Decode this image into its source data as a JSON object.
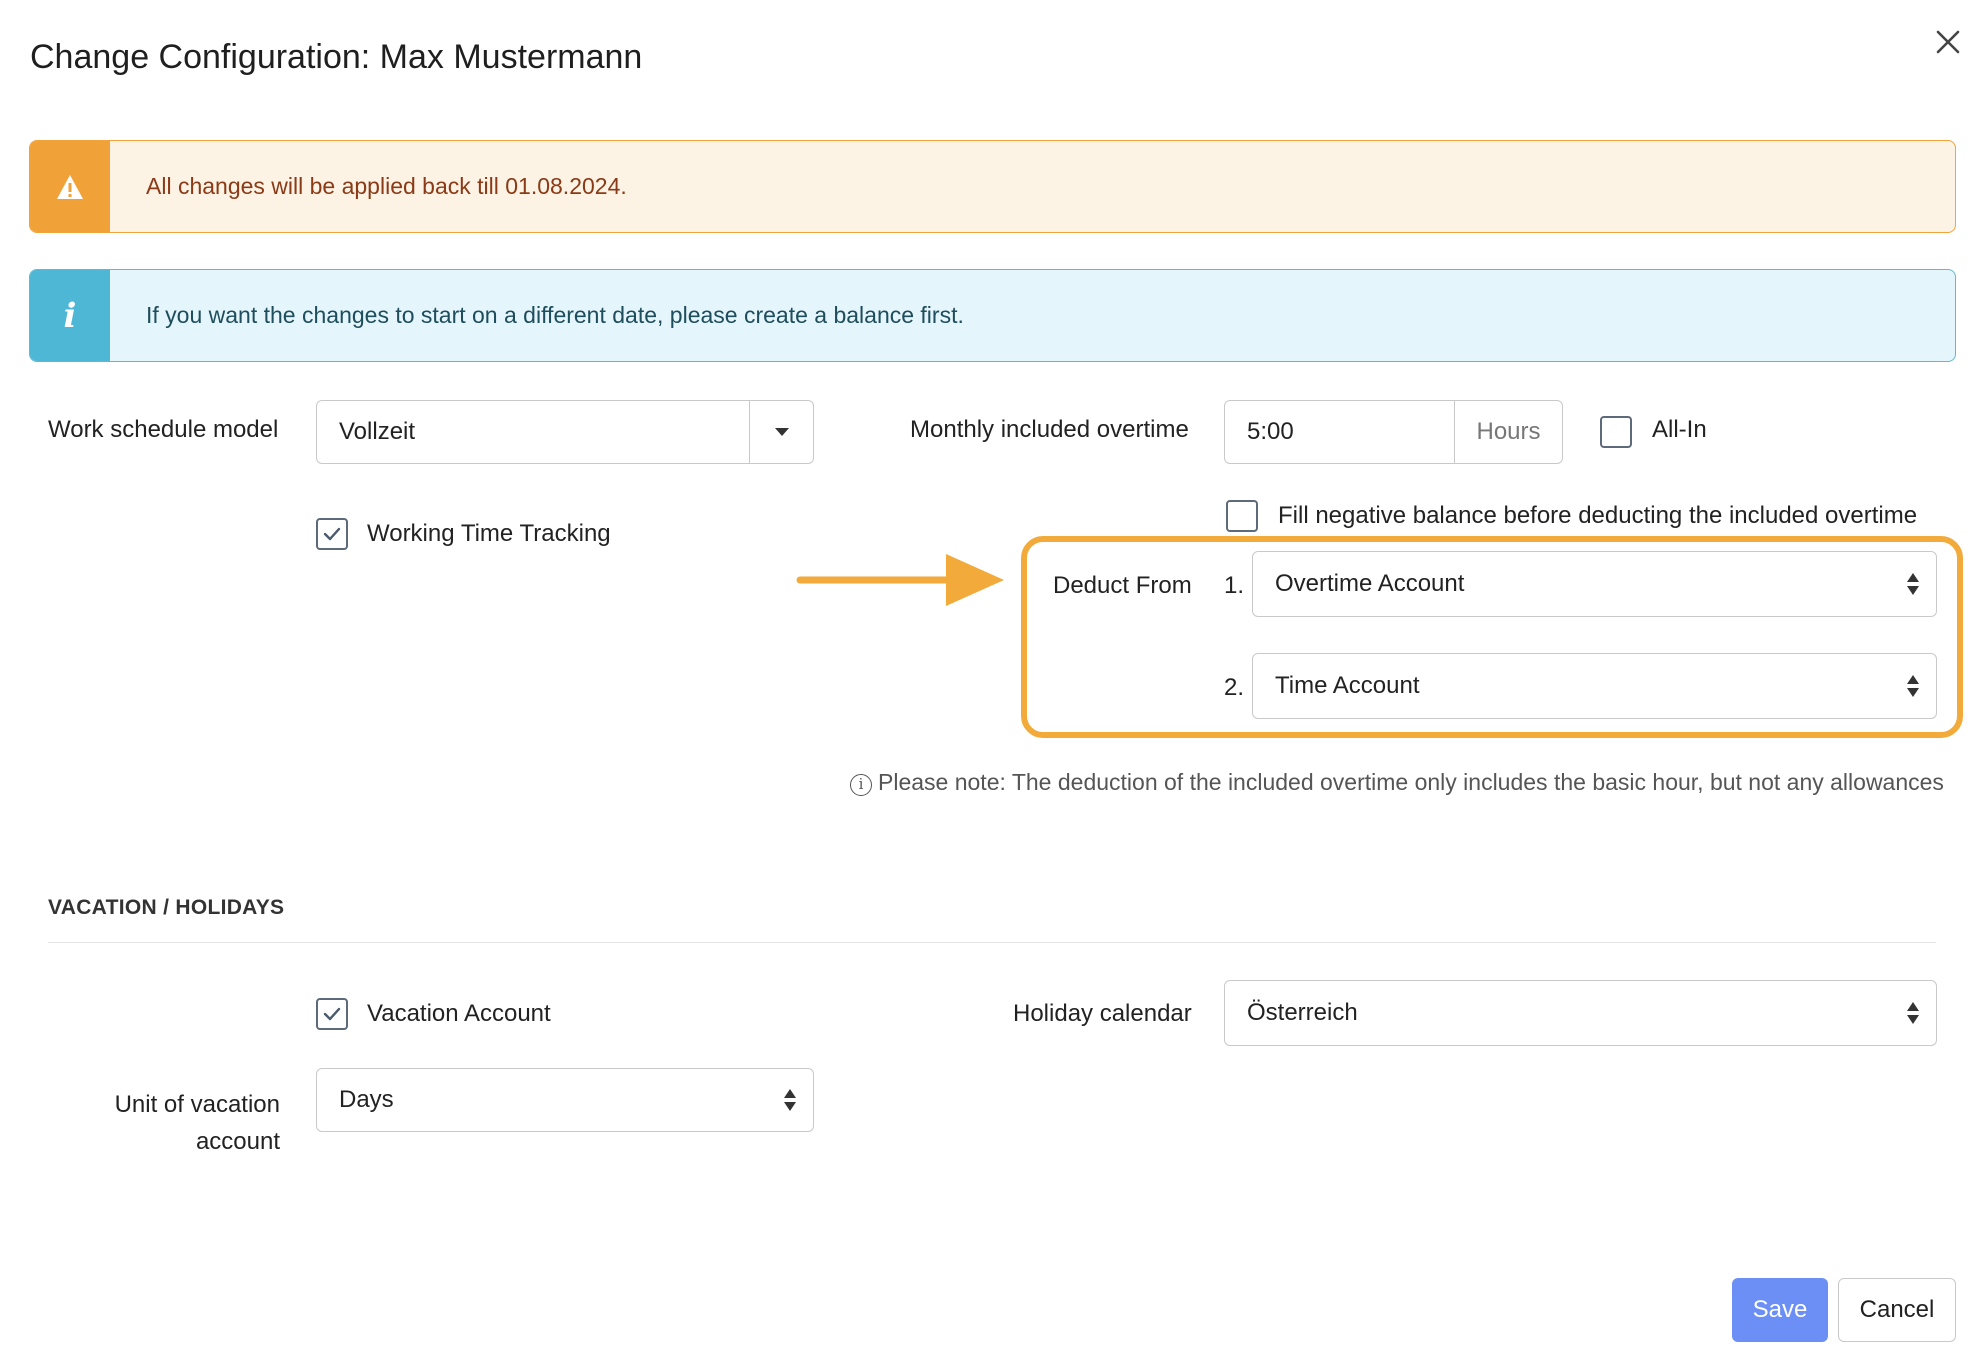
{
  "dialog": {
    "title": "Change Configuration: Max Mustermann"
  },
  "alerts": {
    "warning": "All changes will be applied back till 01.08.2024.",
    "info": "If you want the changes to start on a different date, please create a balance first."
  },
  "work_schedule": {
    "label": "Work schedule model",
    "value": "Vollzeit"
  },
  "working_time_tracking": {
    "label": "Working Time Tracking",
    "checked": true
  },
  "monthly_overtime": {
    "label": "Monthly included overtime",
    "value": "5:00",
    "unit": "Hours"
  },
  "all_in": {
    "label": "All-In",
    "checked": false
  },
  "fill_negative": {
    "label": "Fill negative balance before deducting the included overtime",
    "checked": false
  },
  "deduct_from": {
    "label": "Deduct From",
    "items": [
      {
        "index": "1.",
        "value": "Overtime Account"
      },
      {
        "index": "2.",
        "value": "Time Account"
      }
    ]
  },
  "note": {
    "text": "Please note: The deduction of the included overtime only includes the basic hour, but not any allowances"
  },
  "vacation_section": {
    "heading": "VACATION / HOLIDAYS",
    "vacation_account": {
      "label": "Vacation Account",
      "checked": true
    },
    "holiday_calendar": {
      "label": "Holiday calendar",
      "value": "Österreich"
    },
    "unit": {
      "label_line1": "Unit of vacation",
      "label_line2": "account",
      "value": "Days"
    }
  },
  "buttons": {
    "save": "Save",
    "cancel": "Cancel"
  },
  "colors": {
    "highlight": "#f2aa3a",
    "warning": "#f0a137",
    "info": "#4fb7d6",
    "primary": "#6c8ff5"
  }
}
